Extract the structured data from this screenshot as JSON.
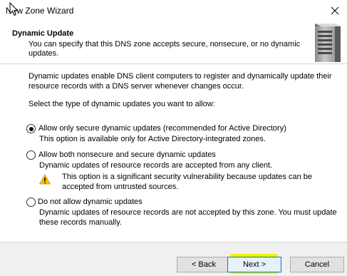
{
  "window": {
    "title": "New Zone Wizard"
  },
  "header": {
    "title": "Dynamic Update",
    "subtitle": "You can specify that this DNS zone accepts secure, nonsecure, or no dynamic updates."
  },
  "content": {
    "intro": "Dynamic updates enable DNS client computers to register and dynamically update their resource records with a DNS server whenever changes occur.",
    "prompt": "Select the type of dynamic updates you want to allow:",
    "options": [
      {
        "label": "Allow only secure dynamic updates (recommended for Active Directory)",
        "description": "This option is available only for Active Directory-integrated zones.",
        "checked": true
      },
      {
        "label": "Allow both nonsecure and secure dynamic updates",
        "description": "Dynamic updates of resource records are accepted from any client.",
        "warning": "This option is a significant security vulnerability because updates can be accepted from untrusted sources.",
        "checked": false
      },
      {
        "label": "Do not allow dynamic updates",
        "description": "Dynamic updates of resource records are not accepted by this zone. You must update these records manually.",
        "checked": false
      }
    ]
  },
  "footer": {
    "back_label": "< Back",
    "next_label": "Next >",
    "cancel_label": "Cancel"
  },
  "colors": {
    "highlight": "#f2f200",
    "warning_icon": "#f5c400",
    "focus_border": "#0078d7"
  }
}
